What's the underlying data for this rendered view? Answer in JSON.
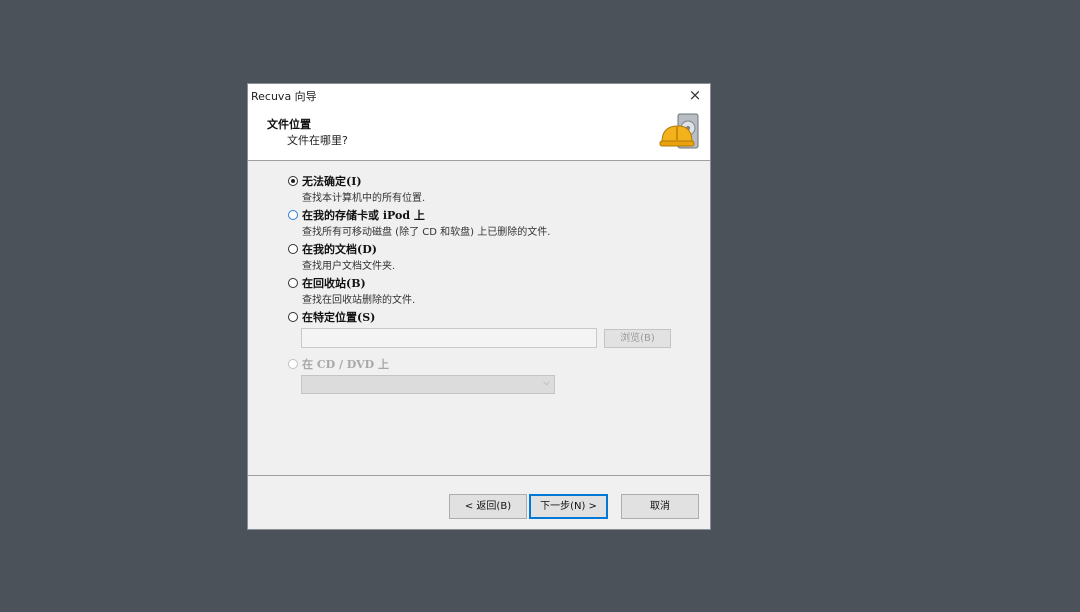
{
  "window": {
    "title": "Recuva 向导",
    "close_symbol": "×"
  },
  "header": {
    "title": "文件位置",
    "subtitle": "文件在哪里?"
  },
  "options": [
    {
      "label": "无法确定(I)",
      "description": "查找本计算机中的所有位置.",
      "checked": true
    },
    {
      "label": "在我的存储卡或 iPod 上",
      "description": "查找所有可移动磁盘 (除了 CD 和软盘) 上已删除的文件.",
      "checked": false
    },
    {
      "label": "在我的文档(D)",
      "description": "查找用户文档文件夹.",
      "checked": false
    },
    {
      "label": "在回收站(B)",
      "description": "查找在回收站删除的文件.",
      "checked": false
    },
    {
      "label": "在特定位置(S)",
      "description": "",
      "checked": false
    },
    {
      "label": "在 CD / DVD 上",
      "description": "",
      "checked": false,
      "disabled": true
    }
  ],
  "specific_location": {
    "path_value": "",
    "browse_label": "浏览(B)"
  },
  "cd_select": {
    "value": ""
  },
  "buttons": {
    "back": "< 返回(B)",
    "next": "下一步(N) >",
    "cancel": "取消"
  },
  "colors": {
    "background": "#4b525a",
    "dialog": "#f0f0f0",
    "focus_blue": "#0078d7"
  },
  "icons": {
    "header_icon": "hard-drive-with-helmet-icon"
  }
}
